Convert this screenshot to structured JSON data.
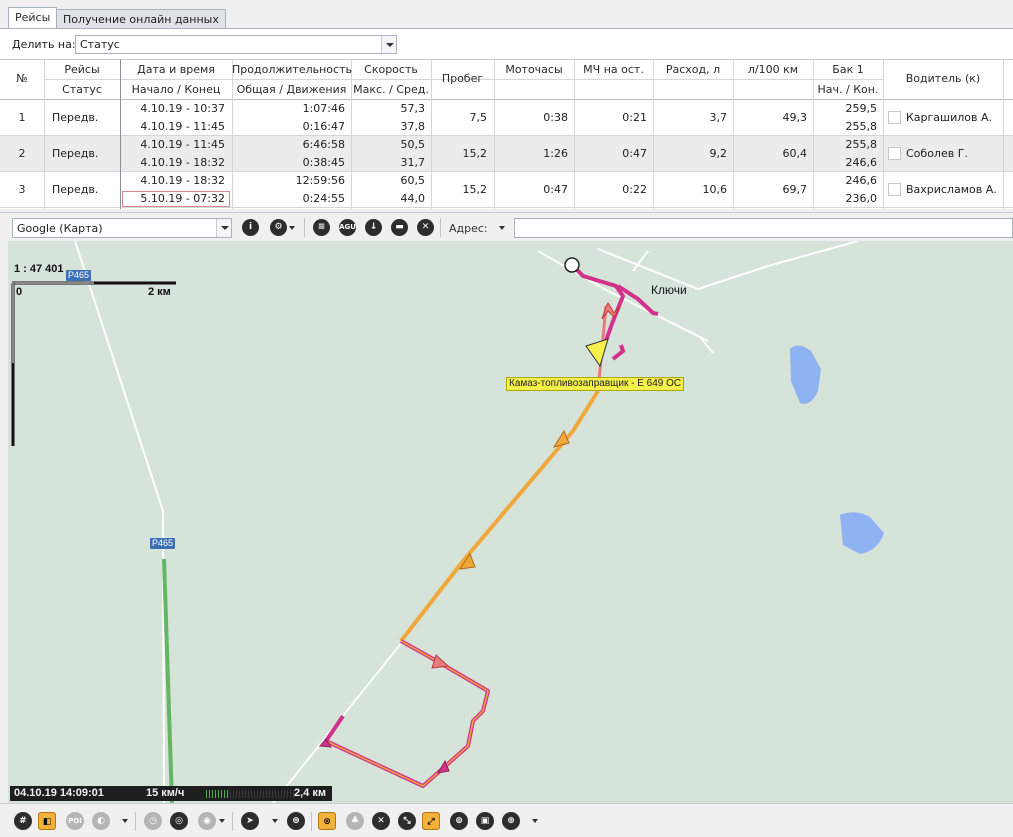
{
  "tabs": [
    {
      "label": "Рейсы",
      "active": true
    },
    {
      "label": "Получение онлайн данных",
      "active": false
    }
  ],
  "filter": {
    "label": "Делить на:",
    "value": "Статус"
  },
  "table": {
    "headers_top": [
      "№",
      "Рейсы",
      "Дата и время",
      "Продолжительность",
      "Скорость",
      "Пробег",
      "Моточасы",
      "МЧ на ост.",
      "Расход, л",
      "л/100 км",
      "Бак 1",
      "Водитель (к)"
    ],
    "headers_sub": [
      "Статус",
      "Начало / Конец",
      "Общая / Движения",
      "Макс. / Сред.",
      "Нач. / Кон."
    ],
    "rows": [
      {
        "n": "1",
        "status": "Передв.",
        "start": "4.10.19 - 10:37",
        "end": "4.10.19 - 11:45",
        "dur_total": "1:07:46",
        "dur_move": "0:16:47",
        "speed_max": "57,3",
        "speed_avg": "37,8",
        "mileage": "7,5",
        "moto": "0:38",
        "moto_idle": "0:21",
        "fuel": "3,7",
        "per100": "49,3",
        "tank_start": "259,5",
        "tank_end": "255,8",
        "driver": "Каргашилов А."
      },
      {
        "n": "2",
        "status": "Передв.",
        "start": "4.10.19 - 11:45",
        "end": "4.10.19 - 18:32",
        "dur_total": "6:46:58",
        "dur_move": "0:38:45",
        "speed_max": "50,5",
        "speed_avg": "31,7",
        "mileage": "15,2",
        "moto": "1:26",
        "moto_idle": "0:47",
        "fuel": "9,2",
        "per100": "60,4",
        "tank_start": "255,8",
        "tank_end": "246,6",
        "driver": "Соболев Г."
      },
      {
        "n": "3",
        "status": "Передв.",
        "start": "4.10.19 - 18:32",
        "end": "5.10.19 - 07:32",
        "dur_total": "12:59:56",
        "dur_move": "0:24:55",
        "speed_max": "60,5",
        "speed_avg": "44,0",
        "mileage": "15,2",
        "moto": "0:47",
        "moto_idle": "0:22",
        "fuel": "10,6",
        "per100": "69,7",
        "tank_start": "246,6",
        "tank_end": "236,0",
        "driver": "Вахрисламов А."
      }
    ]
  },
  "map_toolbar": {
    "provider": "Google (Карта)",
    "address_label": "Адрес:",
    "address_value": "",
    "icons": [
      "info-icon",
      "settings-icon",
      "hatch-icon",
      "agu-icon",
      "download-icon",
      "ruler-icon",
      "pin-off-icon"
    ]
  },
  "map": {
    "scale_ratio": "1 : 47 401",
    "scale_zero": "0",
    "scale_distance": "2 км",
    "place_name": "Ключи",
    "vehicle_label": "Камаз-топливозаправщик - Е 649 ОС",
    "road_label": "Р465",
    "colors": {
      "background": "#d5e3d8",
      "track_orange": "#f0a83a",
      "track_magenta": "#d2328c",
      "track_pink": "#e97a7a",
      "water": "#8fb3f2",
      "road_green": "#64b564"
    }
  },
  "status": {
    "datetime": "04.10.19  14:09:01",
    "speed": "15 км/ч",
    "speed_fill_fraction": 0.25,
    "distance": "2,4 км"
  },
  "bottom_toolbar": {
    "icons": [
      "grid-icon",
      "track-icon",
      "poi-icon",
      "layers-icon",
      "clock-icon",
      "geofence-icon",
      "car-icon",
      "navigate-icon",
      "speed-icon",
      "cancel-icon",
      "tree-icon",
      "close-icon",
      "resize-icon",
      "follow-icon",
      "recenter-icon",
      "photo-icon",
      "target-icon"
    ]
  }
}
